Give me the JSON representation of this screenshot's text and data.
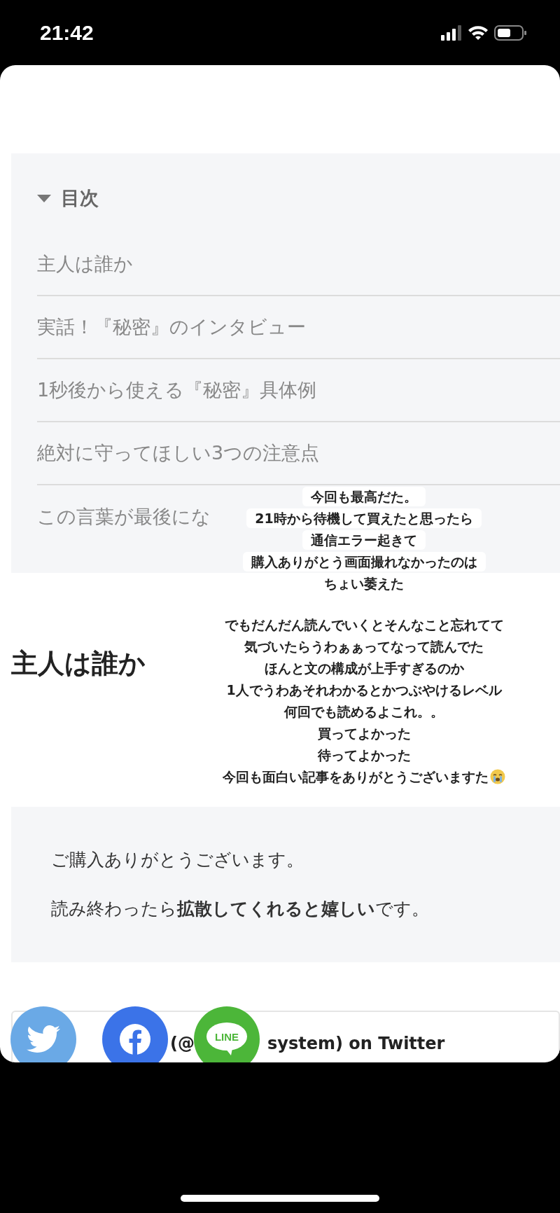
{
  "status_bar": {
    "time": "21:42"
  },
  "toc": {
    "title": "目次",
    "expanded": true,
    "items": [
      {
        "label": "主人は誰か"
      },
      {
        "label": "実話！『秘密』のインタビュー"
      },
      {
        "label": "1秒後から使える『秘密』具体例"
      },
      {
        "label": "絶対に守ってほしい3つの注意点"
      },
      {
        "label": "この言葉が最後にな"
      }
    ]
  },
  "heading": "主人は誰か",
  "thanks_box": {
    "lines": [
      "ご購入ありがとうございます。",
      "読み終わったら**拡散してくれると嬉しい**です。"
    ]
  },
  "embed_card": {
    "title_parts": [
      "(@",
      "system) on Twitter"
    ]
  },
  "share_buttons": [
    {
      "kind": "twitter"
    },
    {
      "kind": "facebook"
    },
    {
      "kind": "line",
      "text": "LINE"
    }
  ],
  "story_overlay": {
    "captions": [
      {
        "kind": "highlighted",
        "lines": [
          "今回も最高だた。",
          "21時から待機して買えたと思ったら",
          "通信エラー起きて",
          "購入ありがとう画面撮れなかったのは",
          "ちょい萎えた"
        ]
      },
      {
        "kind": "plain",
        "lines": [
          "でもだんだん読んでいくとそんなこと忘れてて",
          "気づいたらうわぁぁってなって読んでた",
          "ほんと文の構成が上手すぎるのか",
          "1人でうわあそれわかるとかつぶやけるレベル",
          "何回でも読めるよこれ。。",
          "買ってよかった",
          "待ってよかった",
          "今回も面白い記事をありがとうございますた"
        ]
      }
    ]
  }
}
